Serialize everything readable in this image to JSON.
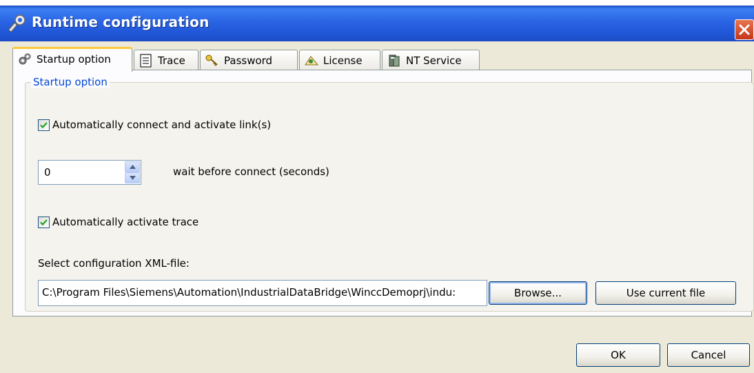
{
  "window": {
    "title": "Runtime configuration"
  },
  "tabs": [
    {
      "label": "Startup option",
      "icon": "gears-icon"
    },
    {
      "label": "Trace",
      "icon": "notepad-icon"
    },
    {
      "label": "Password",
      "icon": "keys-icon"
    },
    {
      "label": "License",
      "icon": "certificate-icon"
    },
    {
      "label": "NT Service",
      "icon": "server-icon"
    }
  ],
  "active_tab": "Startup option",
  "startup": {
    "group_title": "Startup option",
    "auto_connect": {
      "label": "Automatically connect and activate link(s)",
      "checked": true
    },
    "wait": {
      "value": "0",
      "label": "wait before connect (seconds)"
    },
    "auto_trace": {
      "label": "Automatically activate trace",
      "checked": true
    },
    "xml_label": "Select configuration XML-file:",
    "xml_path": "C:\\Program Files\\Siemens\\Automation\\IndustrialDataBridge\\WinccDemoprj\\indu:",
    "browse_label": "Browse...",
    "use_current_label": "Use current file"
  },
  "footer": {
    "ok_label": "OK",
    "cancel_label": "Cancel"
  },
  "colors": {
    "titlebar": "#2a64e3",
    "dialog_bg": "#ece9d8",
    "active_tab_accent": "#ffc83c",
    "group_title": "#0046d5"
  }
}
